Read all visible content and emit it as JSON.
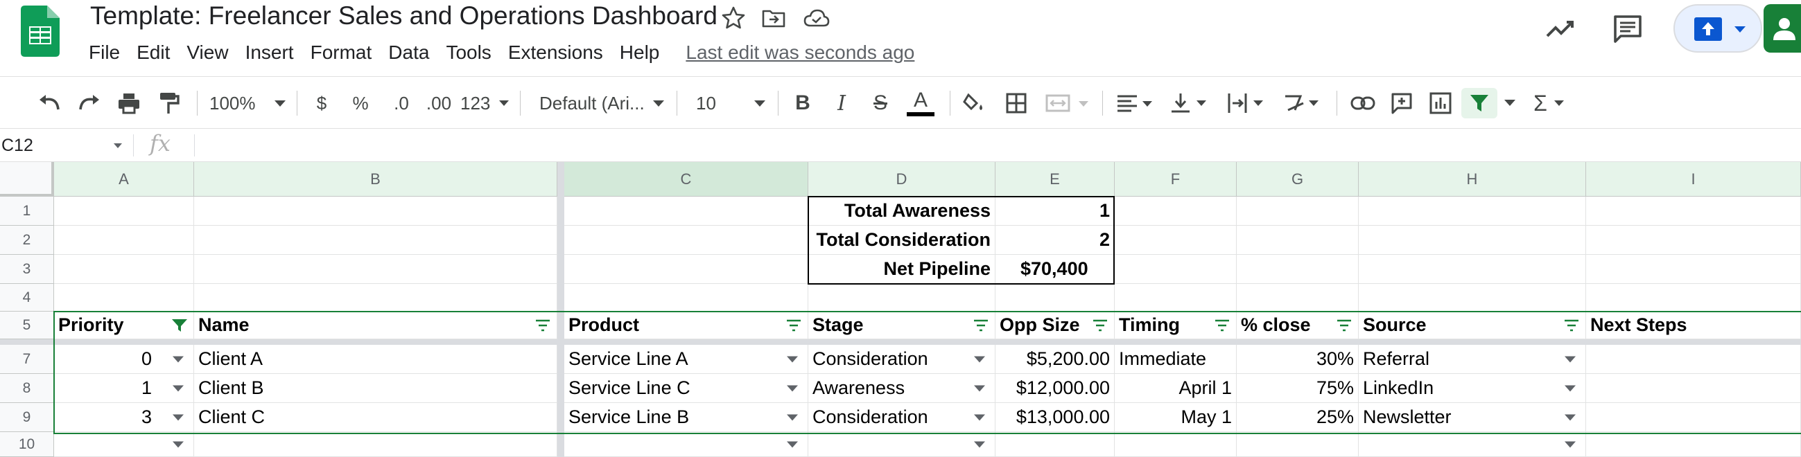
{
  "doc": {
    "title": "Template: Freelancer Sales and Operations Dashboard",
    "last_edit": "Last edit was seconds ago"
  },
  "menu": [
    "File",
    "Edit",
    "View",
    "Insert",
    "Format",
    "Data",
    "Tools",
    "Extensions",
    "Help"
  ],
  "toolbar": {
    "zoom": "100%",
    "currency": "$",
    "percent": "%",
    "dec_decrease": ".0",
    "dec_increase": ".00",
    "more_formats": "123",
    "font": "Default (Ari...",
    "font_size": "10",
    "bold": "B",
    "italic": "I",
    "strike": "S",
    "text_color": "A",
    "sum": "Σ"
  },
  "formula_bar": {
    "cell_ref": "C12",
    "fx": "fx",
    "value": ""
  },
  "columns": [
    "A",
    "B",
    "C",
    "D",
    "E",
    "F",
    "G",
    "H",
    "I"
  ],
  "rows": [
    "1",
    "2",
    "3",
    "4",
    "5",
    "7",
    "8",
    "9",
    "10"
  ],
  "summary": {
    "labels": [
      "Total Awareness",
      "Total Consideration",
      "Net Pipeline"
    ],
    "values": [
      "1",
      "2",
      "$70,400"
    ]
  },
  "table": {
    "headers": [
      "Priority",
      "Name",
      "Product",
      "Stage",
      "Opp Size",
      "Timing",
      "% close",
      "Source",
      "Next Steps"
    ],
    "rows": [
      [
        "0",
        "Client A",
        "Service Line A",
        "Consideration",
        "$5,200.00",
        "Immediate",
        "30%",
        "Referral",
        ""
      ],
      [
        "1",
        "Client B",
        "Service Line C",
        "Awareness",
        "$12,000.00",
        "April 1",
        "75%",
        "LinkedIn",
        ""
      ],
      [
        "3",
        "Client C",
        "Service Line B",
        "Consideration",
        "$13,000.00",
        "May 1",
        "25%",
        "Newsletter",
        ""
      ],
      [
        "",
        "",
        "",
        "",
        "",
        "",
        "",
        "",
        ""
      ]
    ]
  },
  "colors": {
    "accent_green": "#188038",
    "selected_header": "#d3e9d9",
    "header_bg": "#f8f9fa"
  },
  "icons": [
    "sheets-logo-icon",
    "star-icon",
    "move-folder-icon",
    "cloud-saved-icon",
    "activity-trend-icon",
    "comments-icon",
    "present-icon",
    "account-icon"
  ]
}
